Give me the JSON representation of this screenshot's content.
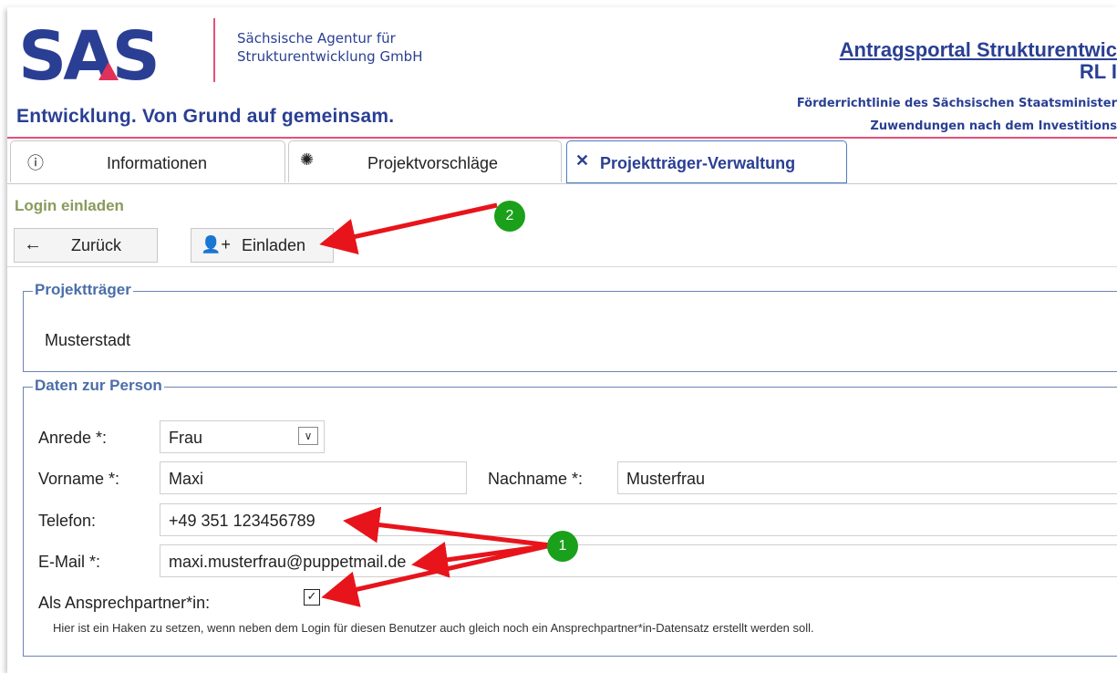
{
  "header": {
    "logo_text": "SAS",
    "agency_line1": "Sächsische Agentur für",
    "agency_line2": "Strukturentwicklung GmbH",
    "slogan": "Entwicklung. Von Grund auf gemeinsam.",
    "portal_title": "Antragsportal Strukturentwic",
    "portal_subtitle": "RL I",
    "portal_line1": "Förderrichtlinie des Sächsischen Staatsminister",
    "portal_line2": "Zuwendungen nach dem Investitions"
  },
  "tabs": [
    {
      "label": "Informationen",
      "icon": "info-icon"
    },
    {
      "label": "Projektvorschläge",
      "icon": "lightbulb-icon"
    },
    {
      "label": "Projektträger-Verwaltung",
      "icon": "tools-icon",
      "active": true
    }
  ],
  "page": {
    "title": "Login einladen",
    "back_label": "Zurück",
    "invite_label": "Einladen"
  },
  "projekttraeger": {
    "legend": "Projektträger",
    "value": "Musterstadt"
  },
  "person": {
    "legend": "Daten zur Person",
    "anrede_label": "Anrede *:",
    "anrede_value": "Frau",
    "vorname_label": "Vorname *:",
    "vorname_value": "Maxi",
    "nachname_label": "Nachname *:",
    "nachname_value": "Musterfrau",
    "telefon_label": "Telefon:",
    "telefon_value": "+49 351 123456789",
    "email_label": "E-Mail *:",
    "email_value": "maxi.musterfrau@puppetmail.de",
    "ansprech_label": "Als Ansprechpartner*in:",
    "ansprech_checked": true,
    "hint": "Hier ist ein Haken zu setzen, wenn neben dem Login für diesen Benutzer auch gleich noch ein Ansprechpartner*in-Datensatz erstellt werden soll."
  },
  "callouts": {
    "one": "1",
    "two": "2"
  },
  "colors": {
    "brand_blue": "#2a3f93",
    "accent_pink": "#e4507a",
    "section_green": "#8a9a5b",
    "legend_blue": "#4a6ea9",
    "callout_green": "#1aa01a",
    "arrow_red": "#e8141b"
  }
}
